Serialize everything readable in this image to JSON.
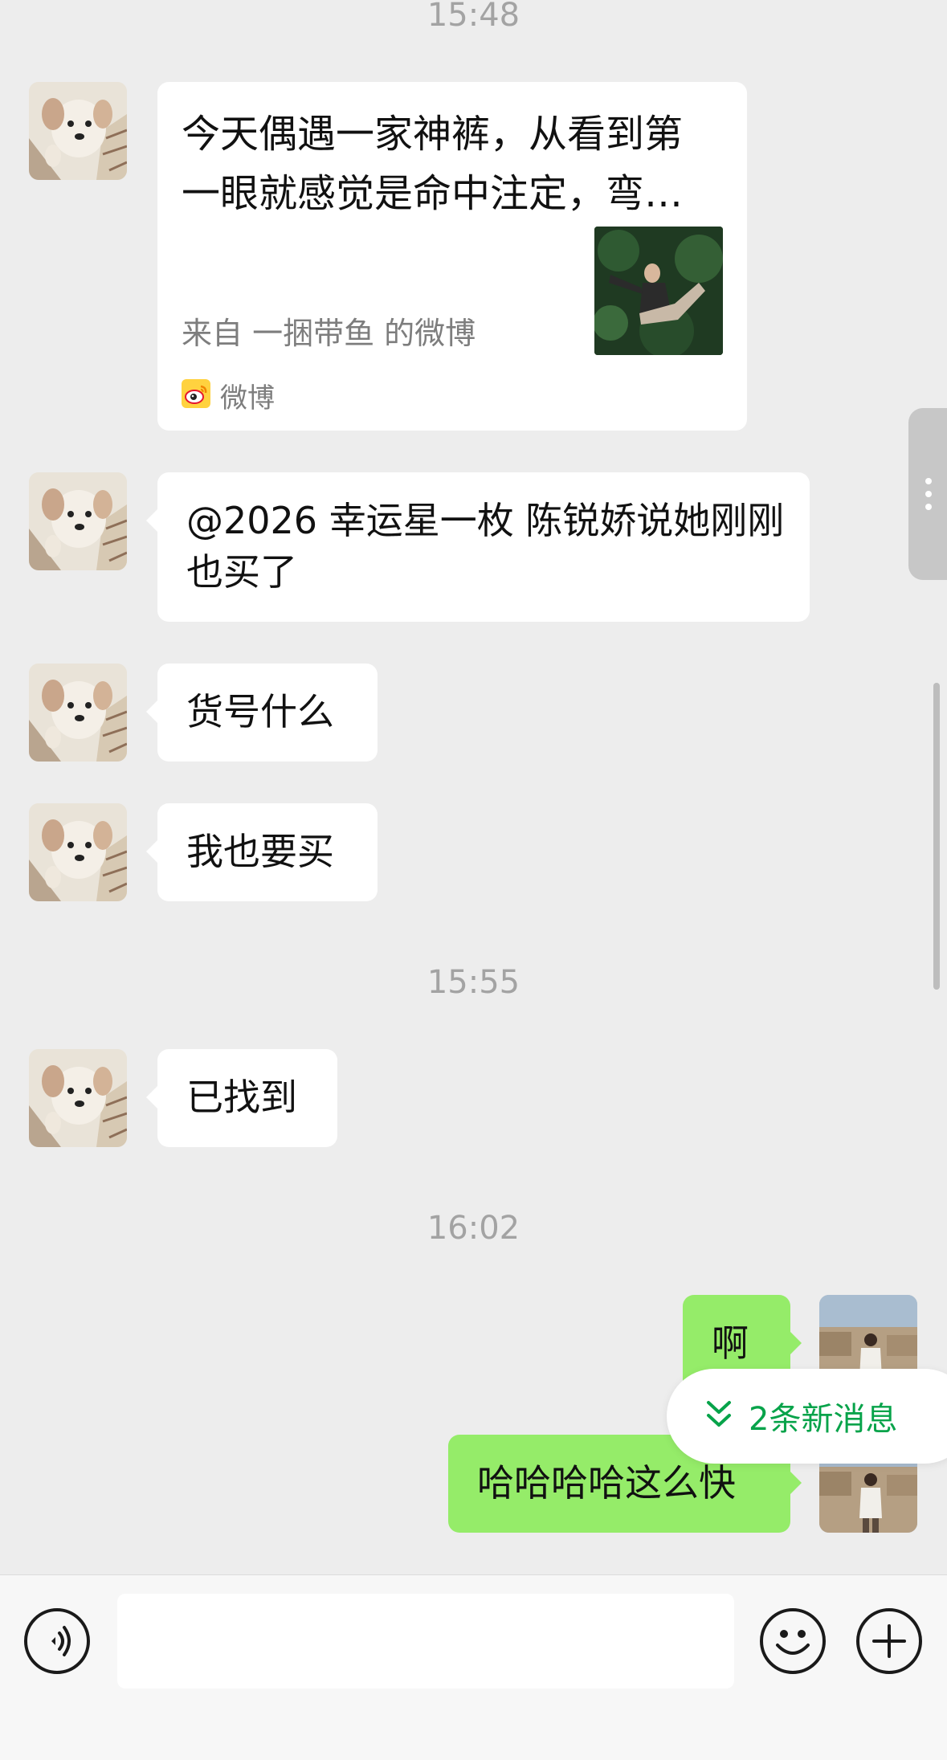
{
  "timestamps": [
    "15:48",
    "15:55",
    "16:02"
  ],
  "shared_card": {
    "title": "今天偶遇一家神裤，从看到第一眼就感觉是命中注定，弯…",
    "source": "来自 一捆带鱼 的微博",
    "app_name": "微博",
    "app_icon": "weibo-icon"
  },
  "messages": {
    "m1": "@2026 幸运星一枚 陈锐娇说她刚刚也买了",
    "m2": "货号什么",
    "m3": "我也要买",
    "m4": "已找到",
    "m5": "啊",
    "m6": "哈哈哈哈这么快"
  },
  "new_messages_pill": "2条新消息",
  "input": {
    "value": "",
    "placeholder": ""
  },
  "icons": {
    "voice": "voice-icon",
    "emoji": "emoji-icon",
    "plus": "plus-icon",
    "more": "more-vertical-icon",
    "chevron": "double-chevron-down-icon"
  },
  "colors": {
    "background": "#ededed",
    "bubble_incoming": "#ffffff",
    "bubble_outgoing": "#95ec69",
    "accent_green": "#07a34a",
    "timestamp": "#a3a3a3"
  }
}
